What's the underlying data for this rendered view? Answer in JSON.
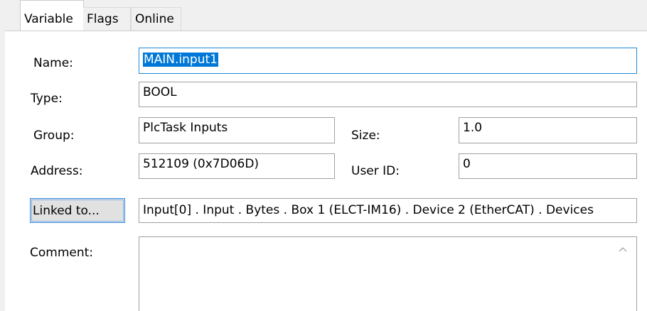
{
  "tabs": [
    {
      "label": "Variable",
      "active": true
    },
    {
      "label": "Flags",
      "active": false
    },
    {
      "label": "Online",
      "active": false
    }
  ],
  "form": {
    "name": {
      "label": "Name:",
      "value": "MAIN.input1"
    },
    "type": {
      "label": "Type:",
      "value": "BOOL"
    },
    "group": {
      "label": "Group:",
      "value": "PlcTask Inputs"
    },
    "size": {
      "label": "Size:",
      "value": "1.0"
    },
    "address": {
      "label": "Address:",
      "value": "512109 (0x7D06D)"
    },
    "user_id": {
      "label": "User ID:",
      "value": "0"
    },
    "linked_to": {
      "button_label": "Linked to...",
      "value": "Input[0] . Input . Bytes . Box 1 (ELCT-IM16) . Device 2 (EtherCAT) . Devices"
    },
    "comment": {
      "label": "Comment:",
      "value": ""
    }
  },
  "icons": {
    "scroll_up": "chevron-up-icon"
  },
  "colors": {
    "selection": "#0078d7",
    "focus_border": "#1e8ad6",
    "button_face": "#e1e1e1",
    "tab_background": "#f0f0f0"
  }
}
